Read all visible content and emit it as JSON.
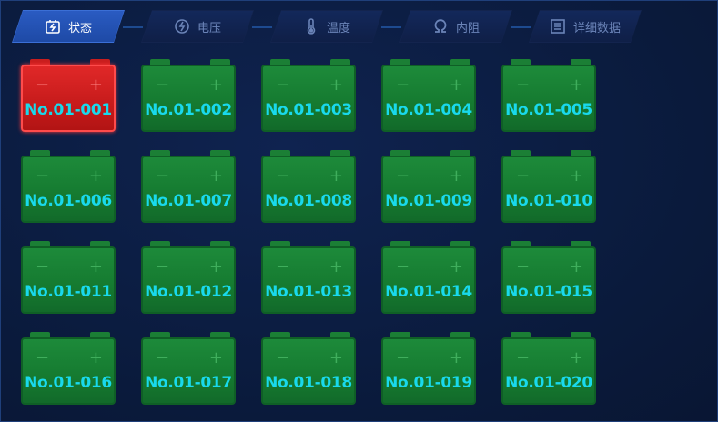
{
  "tabs": [
    {
      "label": "状态",
      "icon": "battery-charge-icon",
      "active": true
    },
    {
      "label": "电压",
      "icon": "power-icon",
      "active": false
    },
    {
      "label": "温度",
      "icon": "thermometer-icon",
      "active": false
    },
    {
      "label": "内阻",
      "icon": "omega-icon",
      "active": false
    },
    {
      "label": "详细数据",
      "icon": "list-icon",
      "active": false
    }
  ],
  "batteries": [
    {
      "id": "No.01-001",
      "status": "alarm"
    },
    {
      "id": "No.01-002",
      "status": "ok"
    },
    {
      "id": "No.01-003",
      "status": "ok"
    },
    {
      "id": "No.01-004",
      "status": "ok"
    },
    {
      "id": "No.01-005",
      "status": "ok"
    },
    {
      "id": "No.01-006",
      "status": "ok"
    },
    {
      "id": "No.01-007",
      "status": "ok"
    },
    {
      "id": "No.01-008",
      "status": "ok"
    },
    {
      "id": "No.01-009",
      "status": "ok"
    },
    {
      "id": "No.01-010",
      "status": "ok"
    },
    {
      "id": "No.01-011",
      "status": "ok"
    },
    {
      "id": "No.01-012",
      "status": "ok"
    },
    {
      "id": "No.01-013",
      "status": "ok"
    },
    {
      "id": "No.01-014",
      "status": "ok"
    },
    {
      "id": "No.01-015",
      "status": "ok"
    },
    {
      "id": "No.01-016",
      "status": "ok"
    },
    {
      "id": "No.01-017",
      "status": "ok"
    },
    {
      "id": "No.01-018",
      "status": "ok"
    },
    {
      "id": "No.01-019",
      "status": "ok"
    },
    {
      "id": "No.01-020",
      "status": "ok"
    }
  ],
  "battery_signs": {
    "minus": "−",
    "plus": "+"
  },
  "colors": {
    "ok": "#1d8a3a",
    "alarm": "#e02828",
    "label": "#19d9ec",
    "active_tab": "#3b6fd6"
  }
}
